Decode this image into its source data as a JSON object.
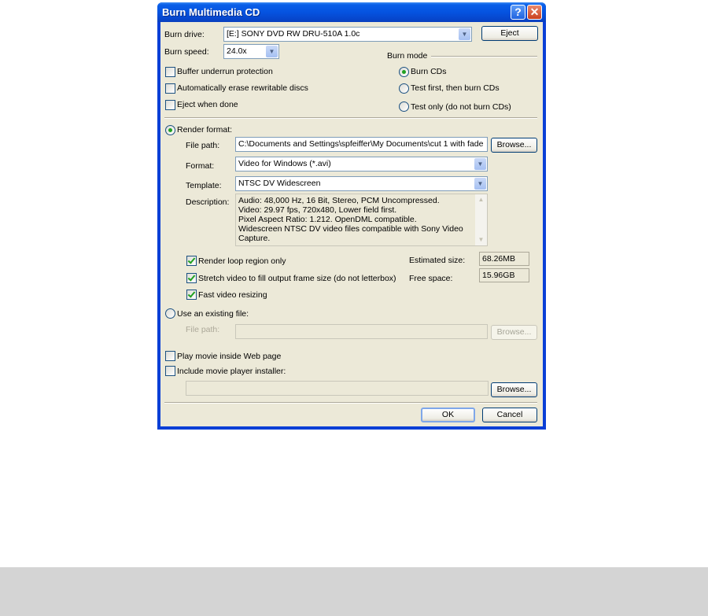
{
  "window": {
    "title": "Burn Multimedia CD",
    "help_glyph": "?",
    "close_glyph": "✕"
  },
  "burn_drive": {
    "label": "Burn drive:",
    "value": "[E:] SONY DVD RW DRU-510A 1.0c"
  },
  "eject_label": "Eject",
  "burn_speed": {
    "label": "Burn speed:",
    "value": "24.0x"
  },
  "options": {
    "buffer_underrun": "Buffer underrun protection",
    "auto_erase": "Automatically erase rewritable discs",
    "eject_when_done": "Eject when done"
  },
  "burn_mode": {
    "label": "Burn mode",
    "burn_cds": "Burn CDs",
    "test_first": "Test first, then burn CDs",
    "test_only": "Test only (do not burn CDs)"
  },
  "render": {
    "label": "Render format:",
    "file_path_label": "File path:",
    "file_path_value": "C:\\Documents and Settings\\spfeiffer\\My Documents\\cut 1 with fade",
    "browse_label": "Browse...",
    "format_label": "Format:",
    "format_value": "Video for Windows (*.avi)",
    "template_label": "Template:",
    "template_value": "NTSC DV Widescreen",
    "description_label": "Description:",
    "description_lines": [
      "Audio: 48,000 Hz, 16 Bit, Stereo, PCM Uncompressed.",
      "Video: 29.97 fps, 720x480, Lower field first.",
      "Pixel Aspect Ratio: 1.212. OpenDML compatible.",
      "Widescreen NTSC DV video files compatible with Sony Video",
      "Capture."
    ],
    "loop_region": "Render loop region only",
    "stretch_video": "Stretch video to fill output frame size (do not letterbox)",
    "fast_resize": "Fast video resizing",
    "est_size_label": "Estimated size:",
    "est_size_value": "68.26MB",
    "free_space_label": "Free space:",
    "free_space_value": "15.96GB"
  },
  "existing": {
    "label": "Use an existing file:",
    "file_path_label": "File path:",
    "file_path_value": "",
    "browse_label": "Browse..."
  },
  "web": {
    "play_inside": "Play movie inside Web page",
    "include_installer": "Include movie player installer:",
    "installer_path": "",
    "browse_label": "Browse..."
  },
  "ok_label": "OK",
  "cancel_label": "Cancel"
}
